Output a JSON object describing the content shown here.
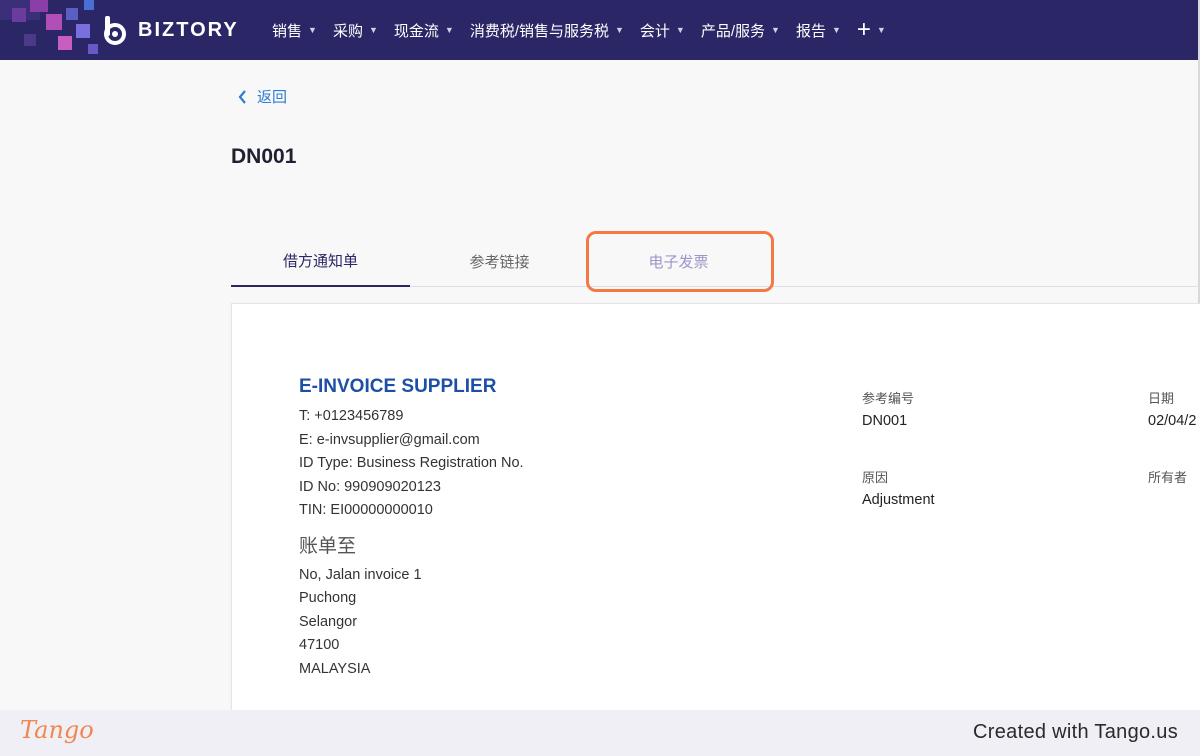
{
  "navbar": {
    "brand": "BIZTORY",
    "brand_color": "#2b2767",
    "menu": [
      {
        "label": "销售",
        "dropdown": true
      },
      {
        "label": "采购",
        "dropdown": true
      },
      {
        "label": "现金流",
        "dropdown": true
      },
      {
        "label": "消费税/销售与服务税",
        "dropdown": true
      },
      {
        "label": "会计",
        "dropdown": true
      },
      {
        "label": "产品/服务",
        "dropdown": true
      },
      {
        "label": "报告",
        "dropdown": true
      }
    ],
    "plus_label": "+"
  },
  "back_label": "返回",
  "page_title": "DN001",
  "tabs": [
    {
      "label": "借方通知单",
      "active": true
    },
    {
      "label": "参考链接",
      "active": false
    },
    {
      "label": "电子发票",
      "active": false,
      "highlighted": true
    }
  ],
  "document": {
    "supplier_name": "E-INVOICE SUPPLIER",
    "supplier_lines": [
      "T: +0123456789",
      "E: e-invsupplier@gmail.com",
      "ID Type: Business Registration No.",
      "ID No: 990909020123",
      "TIN: EI00000000010"
    ],
    "bill_to_title": "账单至",
    "bill_to_lines": [
      "No, Jalan invoice 1",
      "Puchong",
      "Selangor",
      "47100",
      "MALAYSIA"
    ],
    "meta": {
      "reference_label": "参考编号",
      "reference_value": "DN001",
      "date_label": "日期",
      "date_value": "02/04/2",
      "reason_label": "原因",
      "reason_value": "Adjustment",
      "owner_label": "所有者"
    }
  },
  "footer": {
    "logo": "Tango",
    "credit": "Created with Tango.us"
  },
  "colors": {
    "highlight": "#f47a45",
    "supplier_name": "#1e4fa7",
    "link": "#2e7ccf"
  }
}
